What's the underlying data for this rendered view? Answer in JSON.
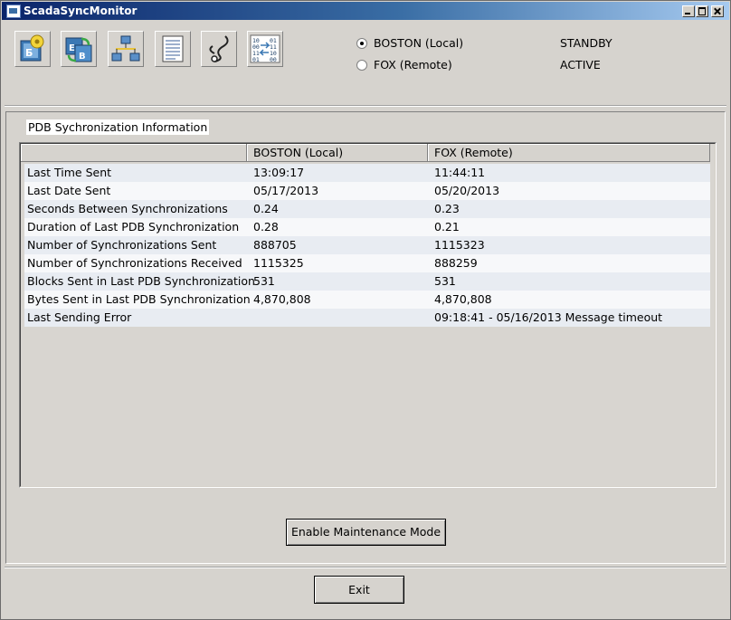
{
  "window": {
    "title": "ScadaSyncMonitor"
  },
  "toolbar": {
    "icons": [
      "database-sync-icon",
      "database-exchange-icon",
      "network-icon",
      "document-icon",
      "cable-icon",
      "binary-transfer-icon"
    ]
  },
  "sites": [
    {
      "label": "BOSTON  (Local)",
      "selected": true,
      "status": "STANDBY"
    },
    {
      "label": "FOX  (Remote)",
      "selected": false,
      "status": "ACTIVE"
    }
  ],
  "group": {
    "title": "PDB Sychronization Information"
  },
  "table": {
    "columns": [
      "",
      "BOSTON  (Local)",
      "FOX  (Remote)"
    ],
    "rows": [
      [
        "Last Time Sent",
        "13:09:17",
        "11:44:11"
      ],
      [
        "Last Date Sent",
        "05/17/2013",
        "05/20/2013"
      ],
      [
        "Seconds Between Synchronizations",
        "0.24",
        "0.23"
      ],
      [
        "Duration of Last PDB Synchronization",
        "0.28",
        "0.21"
      ],
      [
        "Number of Synchronizations Sent",
        "888705",
        "1115323"
      ],
      [
        "Number of Synchronizations Received",
        "1115325",
        "888259"
      ],
      [
        "Blocks Sent in Last PDB Synchronization",
        "531",
        "531"
      ],
      [
        "Bytes Sent in Last PDB Synchronization",
        "4,870,808",
        "4,870,808"
      ],
      [
        "Last Sending Error",
        "",
        "09:18:41 - 05/16/2013 Message timeout"
      ]
    ]
  },
  "buttons": {
    "maintenance": "Enable Maintenance Mode",
    "exit": "Exit"
  }
}
